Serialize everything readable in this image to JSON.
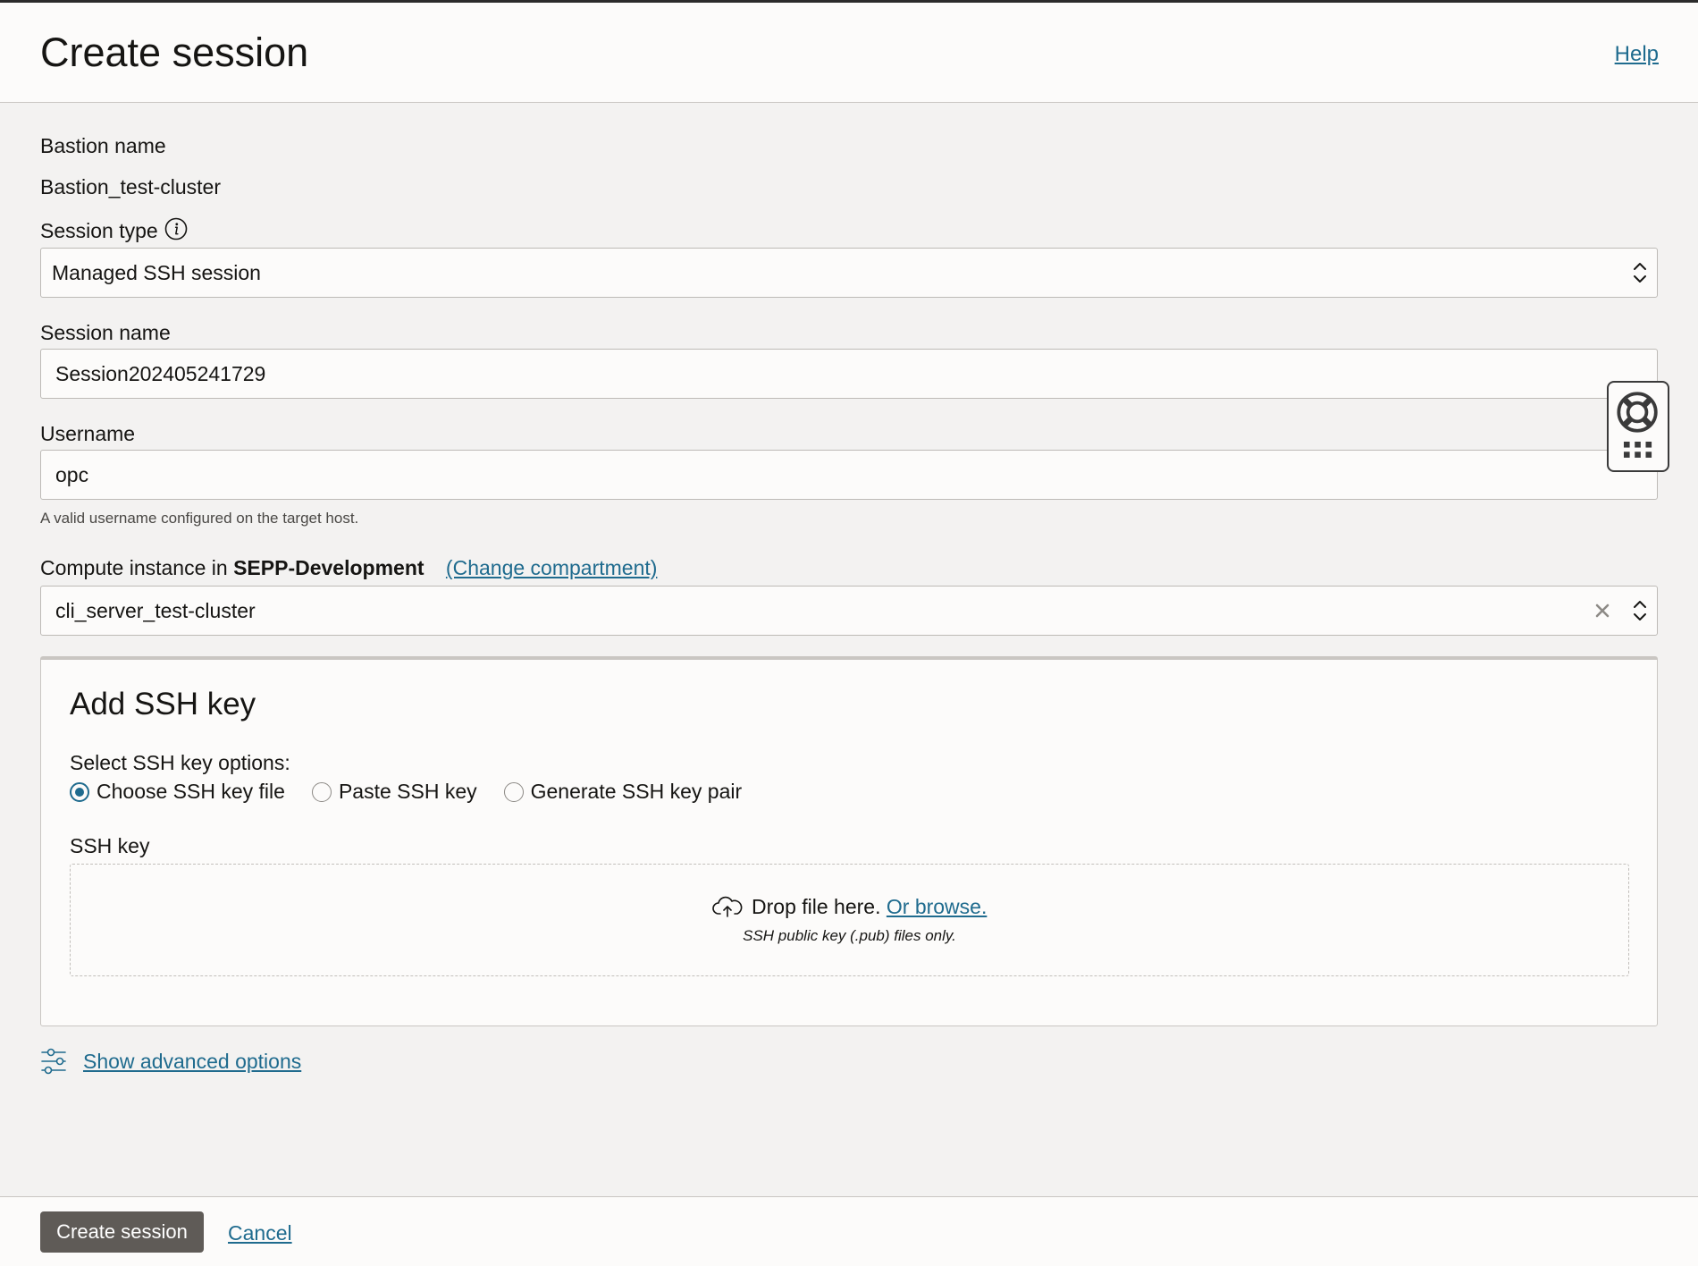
{
  "header": {
    "title": "Create session",
    "help_label": "Help"
  },
  "form": {
    "bastion_name_label": "Bastion name",
    "bastion_name_value": "Bastion_test-cluster",
    "session_type_label": "Session type",
    "session_type_value": "Managed SSH session",
    "session_name_label": "Session name",
    "session_name_value": "Session202405241729",
    "username_label": "Username",
    "username_value": "opc",
    "username_hint": "A valid username configured on the target host.",
    "compute_label": "Compute instance in",
    "compute_compartment": "SEPP-Development",
    "change_compartment_label": "(Change compartment)",
    "compute_value": "cli_server_test-cluster"
  },
  "ssh_panel": {
    "title": "Add SSH key",
    "options_label": "Select SSH key options:",
    "options": [
      {
        "label": "Choose SSH key file",
        "checked": true
      },
      {
        "label": "Paste SSH key",
        "checked": false
      },
      {
        "label": "Generate SSH key pair",
        "checked": false
      }
    ],
    "ssh_key_label": "SSH key",
    "drop_text": "Drop file here.",
    "browse_text": "Or browse.",
    "drop_sub": "SSH public key (.pub) files only."
  },
  "advanced_label": "Show advanced options",
  "footer": {
    "create_label": "Create session",
    "cancel_label": "Cancel"
  },
  "colors": {
    "accent_link": "#1f6b8e",
    "primary_button": "#5f5b57",
    "background": "#f3f2f1"
  }
}
